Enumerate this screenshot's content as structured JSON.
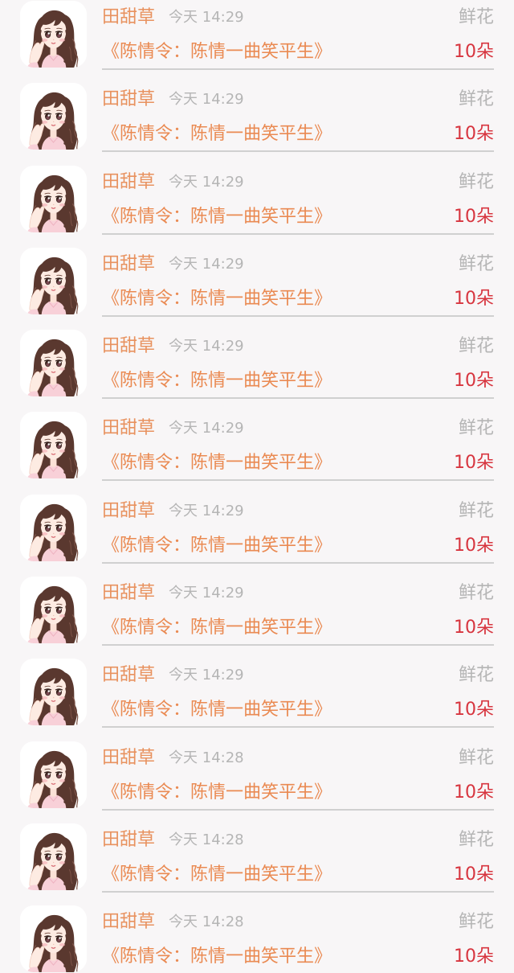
{
  "colors": {
    "background": "#f8f6f7",
    "avatar_background": "#ffffff",
    "user_name": "#e8925f",
    "meta_text": "#b5b5b5",
    "work_title": "#ea8a52",
    "gift_amount": "#d7353f",
    "divider": "#d0d0d0"
  },
  "records": [
    {
      "avatar": "anime-girl-avatar",
      "user_name": "田甜草",
      "time": "今天 14:29",
      "gift_type": "鲜花",
      "work_title": "《陈情令：陈情一曲笑平生》",
      "gift_amount": "10朵"
    },
    {
      "avatar": "anime-girl-avatar",
      "user_name": "田甜草",
      "time": "今天 14:29",
      "gift_type": "鲜花",
      "work_title": "《陈情令：陈情一曲笑平生》",
      "gift_amount": "10朵"
    },
    {
      "avatar": "anime-girl-avatar",
      "user_name": "田甜草",
      "time": "今天 14:29",
      "gift_type": "鲜花",
      "work_title": "《陈情令：陈情一曲笑平生》",
      "gift_amount": "10朵"
    },
    {
      "avatar": "anime-girl-avatar",
      "user_name": "田甜草",
      "time": "今天 14:29",
      "gift_type": "鲜花",
      "work_title": "《陈情令：陈情一曲笑平生》",
      "gift_amount": "10朵"
    },
    {
      "avatar": "anime-girl-avatar",
      "user_name": "田甜草",
      "time": "今天 14:29",
      "gift_type": "鲜花",
      "work_title": "《陈情令：陈情一曲笑平生》",
      "gift_amount": "10朵"
    },
    {
      "avatar": "anime-girl-avatar",
      "user_name": "田甜草",
      "time": "今天 14:29",
      "gift_type": "鲜花",
      "work_title": "《陈情令：陈情一曲笑平生》",
      "gift_amount": "10朵"
    },
    {
      "avatar": "anime-girl-avatar",
      "user_name": "田甜草",
      "time": "今天 14:29",
      "gift_type": "鲜花",
      "work_title": "《陈情令：陈情一曲笑平生》",
      "gift_amount": "10朵"
    },
    {
      "avatar": "anime-girl-avatar",
      "user_name": "田甜草",
      "time": "今天 14:29",
      "gift_type": "鲜花",
      "work_title": "《陈情令：陈情一曲笑平生》",
      "gift_amount": "10朵"
    },
    {
      "avatar": "anime-girl-avatar",
      "user_name": "田甜草",
      "time": "今天 14:29",
      "gift_type": "鲜花",
      "work_title": "《陈情令：陈情一曲笑平生》",
      "gift_amount": "10朵"
    },
    {
      "avatar": "anime-girl-avatar",
      "user_name": "田甜草",
      "time": "今天 14:28",
      "gift_type": "鲜花",
      "work_title": "《陈情令：陈情一曲笑平生》",
      "gift_amount": "10朵"
    },
    {
      "avatar": "anime-girl-avatar",
      "user_name": "田甜草",
      "time": "今天 14:28",
      "gift_type": "鲜花",
      "work_title": "《陈情令：陈情一曲笑平生》",
      "gift_amount": "10朵"
    },
    {
      "avatar": "anime-girl-avatar",
      "user_name": "田甜草",
      "time": "今天 14:28",
      "gift_type": "鲜花",
      "work_title": "《陈情令：陈情一曲笑平生》",
      "gift_amount": "10朵"
    }
  ]
}
